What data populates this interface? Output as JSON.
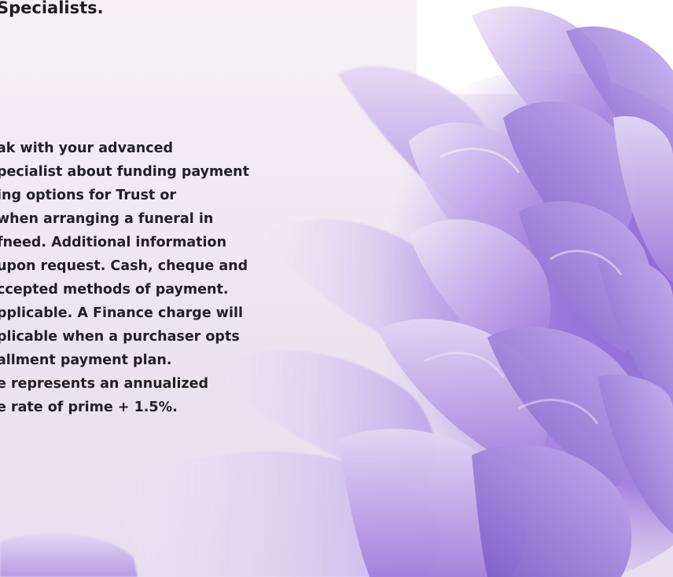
{
  "heading": "Specialists.",
  "body_lines": [
    "ak with your advanced",
    "pecialist about funding payment",
    "ing options for Trust or",
    "when arranging a funeral in",
    "fneed. Additional information",
    "upon request. Cash, cheque and",
    "ccepted methods of payment.",
    "pplicable. A Finance charge will",
    "plicable when a purchaser opts",
    "allment payment plan.",
    "e represents an annualized",
    "e rate of prime + 1.5%."
  ],
  "colors": {
    "text": "#221f26",
    "background": "#f3ecf4",
    "petal_light": "#d9c6ee",
    "petal_mid": "#a886de",
    "petal_dark": "#7b5bc6"
  },
  "image": {
    "icon": "purple-flower-petals-image"
  }
}
